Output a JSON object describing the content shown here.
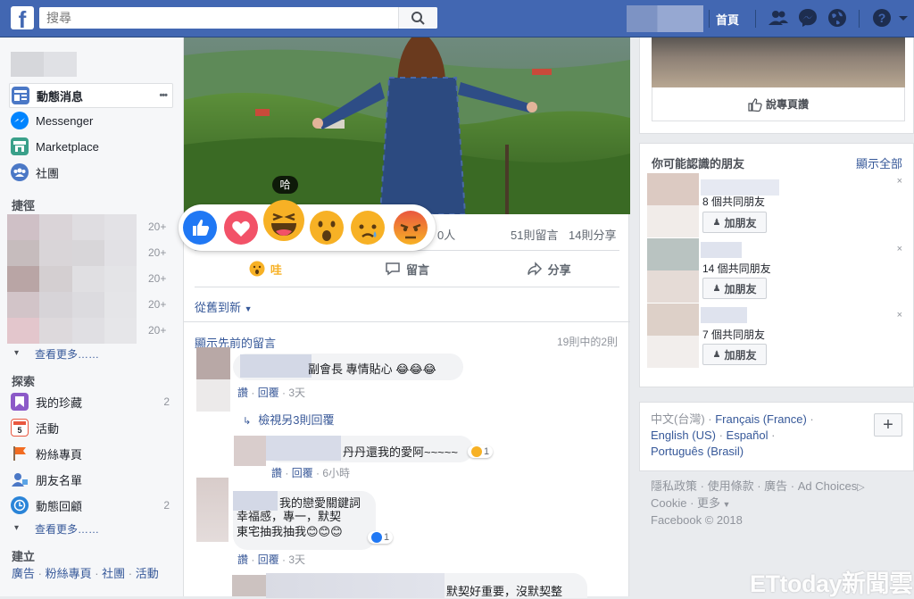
{
  "topbar": {
    "logo": "f",
    "search_placeholder": "搜尋",
    "home_label": "首頁"
  },
  "sidebar": {
    "nav": [
      {
        "label": "動態消息",
        "icon": "news-feed-icon"
      },
      {
        "label": "Messenger",
        "icon": "messenger-icon"
      },
      {
        "label": "Marketplace",
        "icon": "marketplace-icon"
      },
      {
        "label": "社團",
        "icon": "groups-icon"
      }
    ],
    "more_dots": "•••",
    "shortcuts_title": "捷徑",
    "shortcut_counts": [
      "20+",
      "20+",
      "20+",
      "20+",
      "20+"
    ],
    "see_more": "查看更多……",
    "explore_title": "探索",
    "explore": [
      {
        "label": "我的珍藏",
        "count": "2",
        "icon": "saved-icon",
        "color": "#8c5ac8"
      },
      {
        "label": "活動",
        "count": "",
        "icon": "events-icon",
        "color": "#e9573f"
      },
      {
        "label": "粉絲專頁",
        "count": "",
        "icon": "pages-icon",
        "color": "#f26c22"
      },
      {
        "label": "朋友名單",
        "count": "",
        "icon": "friend-lists-icon",
        "color": "#4b78c6"
      },
      {
        "label": "動態回顧",
        "count": "2",
        "icon": "on-this-day-icon",
        "color": "#2a84d8"
      }
    ],
    "see_more_2": "查看更多……",
    "create_title": "建立",
    "create_links": [
      "廣告",
      "粉絲專頁",
      "社團",
      "活動"
    ],
    "create_sep": " · "
  },
  "post": {
    "reactions_suffix": "0人",
    "comments": "51則留言",
    "shares": "14則分享",
    "actions": {
      "wow": "哇",
      "comment": "留言",
      "share": "分享"
    },
    "sort": "從舊到新",
    "prev_comments": "顯示先前的留言",
    "comment_count": "19則中的2則",
    "tooltip": "哈",
    "reactions": [
      "like",
      "love",
      "haha",
      "wow",
      "sad",
      "angry"
    ]
  },
  "comments": [
    {
      "text": "副會長 專情貼心 😂😂😂",
      "meta_like": "讚",
      "meta_reply": "回覆",
      "meta_time": "3天"
    },
    {
      "view_replies": "檢視另3則回覆"
    },
    {
      "text": "丹丹還我的愛阿~~~~~",
      "react_count": "1",
      "meta_like": "讚",
      "meta_reply": "回覆",
      "meta_time": "6小時"
    },
    {
      "text_1": "我的戀愛關鍵詞",
      "text_2": "幸福感，專一，默契",
      "text_3": "東宅抽我抽我😊😊😊",
      "react_count": "1",
      "meta_like": "讚",
      "meta_reply": "回覆",
      "meta_time": "3天"
    },
    {
      "text": "默契好重要，沒默契整"
    }
  ],
  "meta_sep": " · ",
  "right": {
    "like_page": "說專頁讚",
    "pymk_title": "你可能認識的朋友",
    "see_all": "顯示全部",
    "friends": [
      {
        "mutual": "8 個共同朋友",
        "add": "加朋友"
      },
      {
        "mutual": "14 個共同朋友",
        "add": "加朋友"
      },
      {
        "mutual": "7 個共同朋友",
        "add": "加朋友"
      }
    ],
    "close": "×",
    "languages": [
      "中文(台灣)",
      "Français (France)",
      "English (US)",
      "Español",
      "Português (Brasil)"
    ],
    "lang_plus": "+",
    "footer_links": [
      "隱私政策",
      "使用條款",
      "廣告",
      "Ad Choices",
      "Cookie",
      "更多"
    ],
    "copyright": "Facebook © 2018"
  },
  "watermark": "ETtoday新聞雲",
  "colors": {
    "brand": "#4267b2",
    "link": "#365899",
    "wow": "#f7b125"
  }
}
